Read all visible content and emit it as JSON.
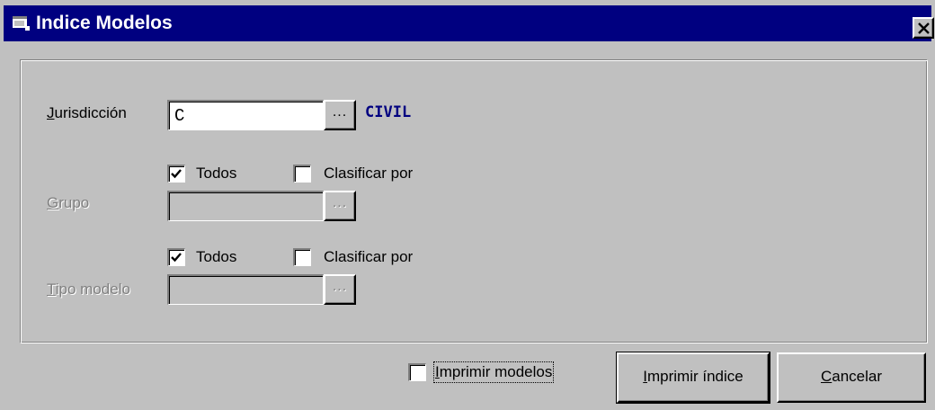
{
  "window": {
    "title": "Indice Modelos",
    "close_label": "close"
  },
  "icons": {
    "app": "window-app-icon",
    "close": "close-icon",
    "check": "checkmark-icon"
  },
  "colors": {
    "titlebar": "#000080",
    "face": "#c0c0c0",
    "value_text": "#000080"
  },
  "form": {
    "jurisdiccion": {
      "label_first": "J",
      "label_rest": "urisdicción",
      "value": "C",
      "browse_label": "...",
      "description": "CIVIL"
    },
    "grupo": {
      "todos_label": "Todos",
      "todos_checked": true,
      "clasificar_label": "Clasificar por",
      "clasificar_checked": false,
      "label_first": "G",
      "label_rest": "rupo",
      "value": "",
      "browse_label": "..."
    },
    "tipo_modelo": {
      "todos_label": "Todos",
      "todos_checked": true,
      "clasificar_label": "Clasificar por",
      "clasificar_checked": false,
      "label_first": "T",
      "label_rest": "ipo modelo",
      "value": "",
      "browse_label": "..."
    }
  },
  "footer": {
    "imprimir_modelos_first": "I",
    "imprimir_modelos_rest": "mprimir modelos",
    "imprimir_modelos_checked": false,
    "imprimir_indice_first": "I",
    "imprimir_indice_rest": "mprimir índice",
    "cancelar_first": "C",
    "cancelar_rest": "ancelar"
  }
}
